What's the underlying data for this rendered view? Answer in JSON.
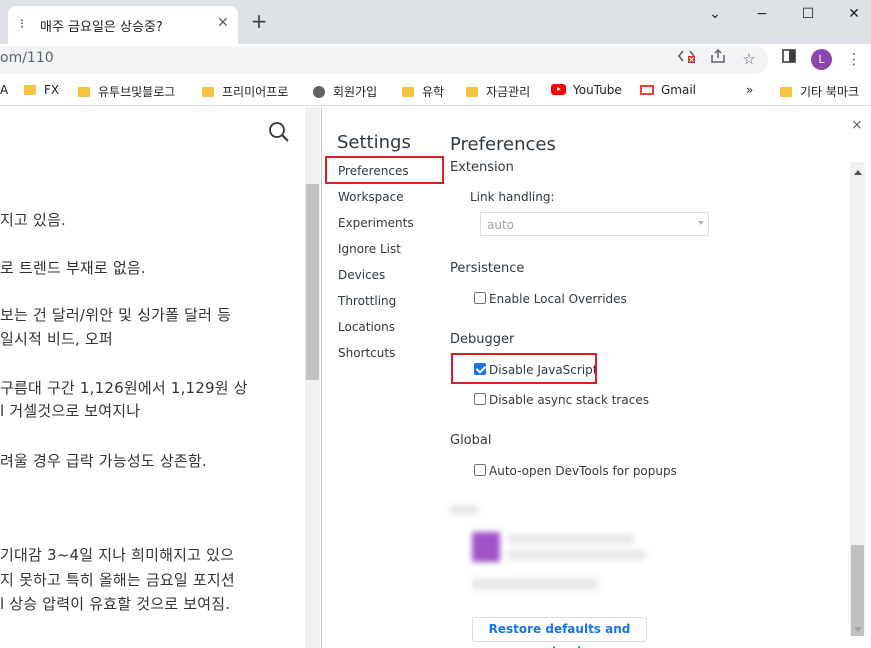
{
  "browser": {
    "tab_title": "매주 금요일은 상승중?",
    "tab_favicon": "tistory-icon",
    "url": "om/110",
    "window": {
      "minimize": "−",
      "maximize": "☐",
      "close": "✕",
      "chevron": "⌄"
    },
    "avatar_letter": "L"
  },
  "bookmarks": {
    "items": [
      {
        "label": "A",
        "icon": "folder-icon"
      },
      {
        "label": "FX",
        "icon": "folder-icon"
      },
      {
        "label": "유투브및블로그",
        "icon": "folder-icon"
      },
      {
        "label": "프리미어프로",
        "icon": "folder-icon"
      },
      {
        "label": "회원가입",
        "icon": "globe-icon"
      },
      {
        "label": "유학",
        "icon": "folder-icon"
      },
      {
        "label": "자금관리",
        "icon": "folder-icon"
      },
      {
        "label": "YouTube",
        "icon": "youtube-icon"
      },
      {
        "label": "Gmail",
        "icon": "gmail-icon"
      }
    ],
    "overflow": "»",
    "other": "기타 북마크"
  },
  "page": {
    "lines": [
      "지고 있음.",
      "로 트렌드 부재로 없음.",
      "보는 건 달러/위안 및 싱가폴 달러 등",
      "일시적 비드, 오퍼",
      " 구름대 구간 1,126원에서 1,129원 상",
      "l 거셀것으로 보여지나",
      "려울 경우 급락 가능성도 상존함.",
      "기대감 3~4일 지나 희미해지고 있으",
      "지 못하고 특히 올해는 금요일 포지션",
      "l 상승 압력이 유효할 것으로 보여짐."
    ]
  },
  "devtools": {
    "settings_title": "Settings",
    "close_label": "×",
    "sidebar": [
      "Preferences",
      "Workspace",
      "Experiments",
      "Ignore List",
      "Devices",
      "Throttling",
      "Locations",
      "Shortcuts"
    ],
    "selected_index": 0,
    "panel_title": "Preferences",
    "extension_section": "Extension",
    "link_handling_label": "Link handling:",
    "link_handling_value": "auto",
    "persistence_section": "Persistence",
    "enable_local_overrides": {
      "label": "Enable Local Overrides",
      "checked": false
    },
    "debugger_section": "Debugger",
    "disable_javascript": {
      "label": "Disable JavaScript",
      "checked": true
    },
    "disable_async": {
      "label": "Disable async stack traces",
      "checked": false
    },
    "global_section": "Global",
    "auto_open_devtools": {
      "label": "Auto-open DevTools for popups",
      "checked": false
    },
    "restore_button": "Restore defaults and reload"
  },
  "colors": {
    "highlight_red": "#e01b24",
    "checkbox_blue": "#1a73e8",
    "link_blue": "#1a73e8"
  }
}
